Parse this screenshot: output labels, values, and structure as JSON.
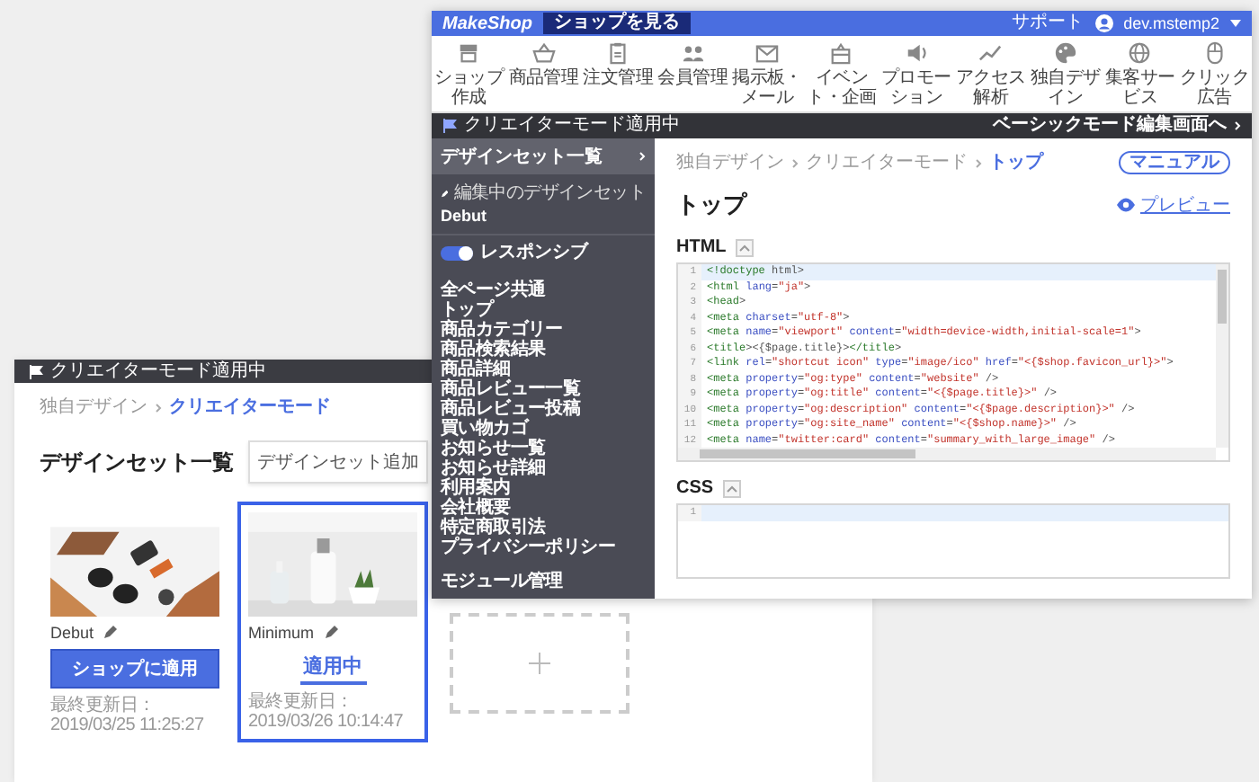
{
  "back_window": {
    "mode_status": "クリエイターモード適用中",
    "breadcrumb": [
      {
        "label": "独自デザイン",
        "current": false
      },
      {
        "label": "クリエイターモード",
        "current": true
      }
    ],
    "title": "デザインセット一覧",
    "add_button": "デザインセット追加",
    "design_sets": [
      {
        "name": "Debut",
        "selected": false,
        "action": "ショップに適用",
        "updated": "最終更新日：2019/03/25 11:25:27"
      },
      {
        "name": "Minimum",
        "selected": true,
        "action": "適用中",
        "updated": "最終更新日：2019/03/26 10:14:47"
      }
    ]
  },
  "front_window": {
    "header": {
      "logo": "MakeShop",
      "view_shop_button": "ショップを見る",
      "support": "サポート",
      "user": "dev.mstemp2"
    },
    "nav": [
      "ショップ作成",
      "商品管理",
      "注文管理",
      "会員管理",
      "掲示板・メール",
      "イベント・企画",
      "プロモーション",
      "アクセス解析",
      "独自デザイン",
      "集客サービス",
      "クリック広告"
    ],
    "mode_bar": {
      "status": "クリエイターモード適用中",
      "link": "ベーシックモード編集画面へ"
    },
    "sidebar": {
      "top_item": {
        "label": "デザインセット一覧",
        "selected": true
      },
      "editing_label": "編集中のデザインセット",
      "editing_name": "Debut",
      "responsive": {
        "label": "レスポンシブ",
        "on": true
      },
      "pages": [
        "全ページ共通",
        "トップ",
        "商品カテゴリー",
        "商品検索結果",
        "商品詳細",
        "商品レビュー一覧",
        "商品レビュー投稿",
        "買い物カゴ",
        "お知らせ一覧",
        "お知らせ詳細",
        "利用案内",
        "会社概要",
        "特定商取引法",
        "プライバシーポリシー"
      ],
      "module_item": "モジュール管理"
    },
    "main": {
      "breadcrumb": [
        {
          "label": "独自デザイン",
          "current": false
        },
        {
          "label": "クリエイターモード",
          "current": false
        },
        {
          "label": "トップ",
          "current": true
        }
      ],
      "manual_button": "マニュアル",
      "title": "トップ",
      "preview_link": "プレビュー",
      "editors": [
        {
          "label": "HTML",
          "lines": [
            {
              "number": "1",
              "code": "<!doctype html>",
              "active": true
            },
            {
              "number": "2",
              "code": "<html lang=\"ja\">",
              "active": false
            },
            {
              "number": "3",
              "code": "<head>",
              "active": false
            },
            {
              "number": "4",
              "code": "<meta charset=\"utf-8\">",
              "active": false
            },
            {
              "number": "5",
              "code": "<meta name=\"viewport\" content=\"width=device-width,initial-scale=1\">",
              "active": false
            },
            {
              "number": "6",
              "code": "<title><{$page.title}></title>",
              "active": false
            },
            {
              "number": "7",
              "code": "<link rel=\"shortcut icon\" type=\"image/ico\" href=\"<{$shop.favicon_url}>\">",
              "active": false
            },
            {
              "number": "8",
              "code": "<meta property=\"og:type\" content=\"website\" />",
              "active": false
            },
            {
              "number": "9",
              "code": "<meta property=\"og:title\" content=\"<{$page.title}>\" />",
              "active": false
            },
            {
              "number": "10",
              "code": "<meta property=\"og:description\" content=\"<{$page.description}>\" />",
              "active": false
            },
            {
              "number": "11",
              "code": "<meta property=\"og:site_name\" content=\"<{$shop.name}>\" />",
              "active": false
            },
            {
              "number": "12",
              "code": "<meta name=\"twitter:card\" content=\"summary_with_large_image\" />",
              "active": false
            }
          ]
        },
        {
          "label": "CSS",
          "lines": [
            {
              "number": "1",
              "active": true
            }
          ]
        }
      ]
    }
  }
}
